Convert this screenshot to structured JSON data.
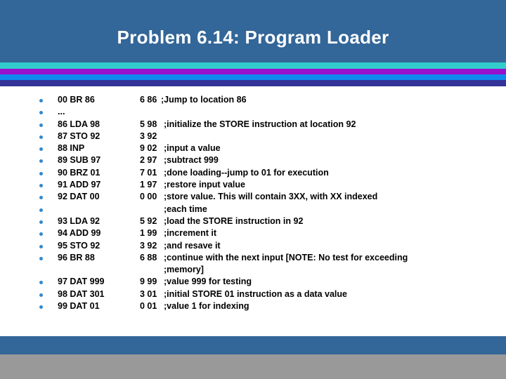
{
  "title": "Problem 6.14: Program Loader",
  "colors": {
    "header": "#336699",
    "stripes": [
      "#33cccc",
      "#9911cc",
      "#1188ee",
      "#333399"
    ],
    "footer_band": "#336699",
    "footer_gray": "#999999",
    "bullet": "#3388cc"
  },
  "rows": [
    {
      "bullet": true,
      "code": "00 BR 86",
      "machine": "6 86",
      "comment": ";Jump to location 86"
    },
    {
      "bullet": true,
      "code": "...",
      "machine": "",
      "comment": ""
    },
    {
      "bullet": true,
      "code": "86 LDA 98",
      "machine": "5 98",
      "comment": ";initialize the STORE instruction at location 92"
    },
    {
      "bullet": true,
      "code": "87 STO 92",
      "machine": "3 92",
      "comment": ""
    },
    {
      "bullet": true,
      "code": "88 INP",
      "machine": "9 02",
      "comment": ";input a value"
    },
    {
      "bullet": true,
      "code": "89 SUB 97",
      "machine": "2 97",
      "comment": ";subtract 999"
    },
    {
      "bullet": true,
      "code": "90 BRZ 01",
      "machine": "7 01",
      "comment": ";done loading--jump to 01 for execution"
    },
    {
      "bullet": true,
      "code": "91 ADD 97",
      "machine": "1 97",
      "comment": ";restore input value"
    },
    {
      "bullet": true,
      "code": "92 DAT 00",
      "machine": "0 00",
      "comment": ";store value. This will contain 3XX, with XX indexed"
    },
    {
      "bullet": true,
      "code": "",
      "machine": "",
      "comment": ";each time"
    },
    {
      "bullet": true,
      "code": "93 LDA 92",
      "machine": "5 92",
      "comment": ";load the STORE instruction in 92"
    },
    {
      "bullet": true,
      "code": "94 ADD 99",
      "machine": "1 99",
      "comment": ";increment it"
    },
    {
      "bullet": true,
      "code": "95 STO 92",
      "machine": "3 92",
      "comment": ";and resave it"
    },
    {
      "bullet": true,
      "code": "96 BR 88",
      "machine": "6 88",
      "comment": ";continue with the next input [NOTE: No test for exceeding"
    },
    {
      "bullet": false,
      "code": "",
      "machine": "",
      "comment": ";memory]"
    },
    {
      "bullet": true,
      "code": "97 DAT 999",
      "machine": "9 99",
      "comment": ";value 999 for testing"
    },
    {
      "bullet": true,
      "code": "98 DAT 301",
      "machine": "3 01",
      "comment": ";initial STORE 01 instruction as a data value"
    },
    {
      "bullet": true,
      "code": "99 DAT 01",
      "machine": "0 01",
      "comment": ";value 1 for indexing"
    }
  ]
}
